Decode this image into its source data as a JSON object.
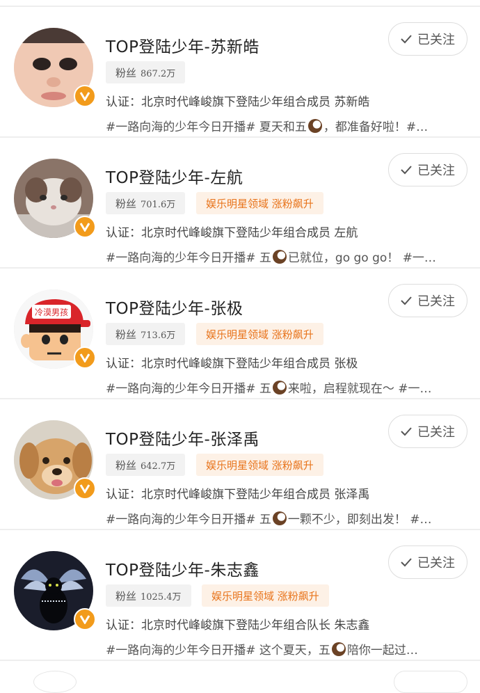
{
  "follow_label": "已关注",
  "fans_label": "粉丝",
  "tag_label": "娱乐明星领域 涨粉飙升",
  "users": [
    {
      "name": "TOP登陆少年-苏新皓",
      "fans": "867.2万",
      "has_tag": false,
      "cert": "认证：北京时代峰峻旗下登陆少年组合成员 苏新皓",
      "desc_a": "#一路向海的少年今日开播# 夏天和五",
      "desc_b": "，都准备好啦！#…",
      "avatar_icon": "face-photo"
    },
    {
      "name": "TOP登陆少年-左航",
      "fans": "701.6万",
      "has_tag": true,
      "cert": "认证：北京时代峰峻旗下登陆少年组合成员 左航",
      "desc_a": "#一路向海的少年今日开播# 五",
      "desc_b": "已就位，go go go！ #一…",
      "avatar_icon": "cat-photo"
    },
    {
      "name": "TOP登陆少年-张极",
      "fans": "713.6万",
      "has_tag": true,
      "cert": "认证：北京时代峰峻旗下登陆少年组合成员 张极",
      "desc_a": "#一路向海的少年今日开播# 五",
      "desc_b": "来啦，启程就现在～ #一…",
      "avatar_icon": "cartoon-boy",
      "avatar_text": "冷漠男孩"
    },
    {
      "name": "TOP登陆少年-张泽禹",
      "fans": "642.7万",
      "has_tag": true,
      "cert": "认证：北京时代峰峻旗下登陆少年组合成员 张泽禹",
      "desc_a": "#一路向海的少年今日开播# 五",
      "desc_b": "一颗不少，即刻出发！ #…",
      "avatar_icon": "puppy-photo"
    },
    {
      "name": "TOP登陆少年-朱志鑫",
      "fans": "1025.4万",
      "has_tag": true,
      "cert": "认证：北京时代峰峻旗下登陆少年组合队长 朱志鑫",
      "desc_a": "#一路向海的少年今日开播# 这个夏天，五",
      "desc_b": "陪你一起过…",
      "avatar_icon": "black-cat-wings"
    }
  ],
  "colors": {
    "tag_text": "#e8731a",
    "tag_bg": "#fdf1e6",
    "badge": "#f29b1b",
    "fans_bg": "#f2f2f2"
  }
}
